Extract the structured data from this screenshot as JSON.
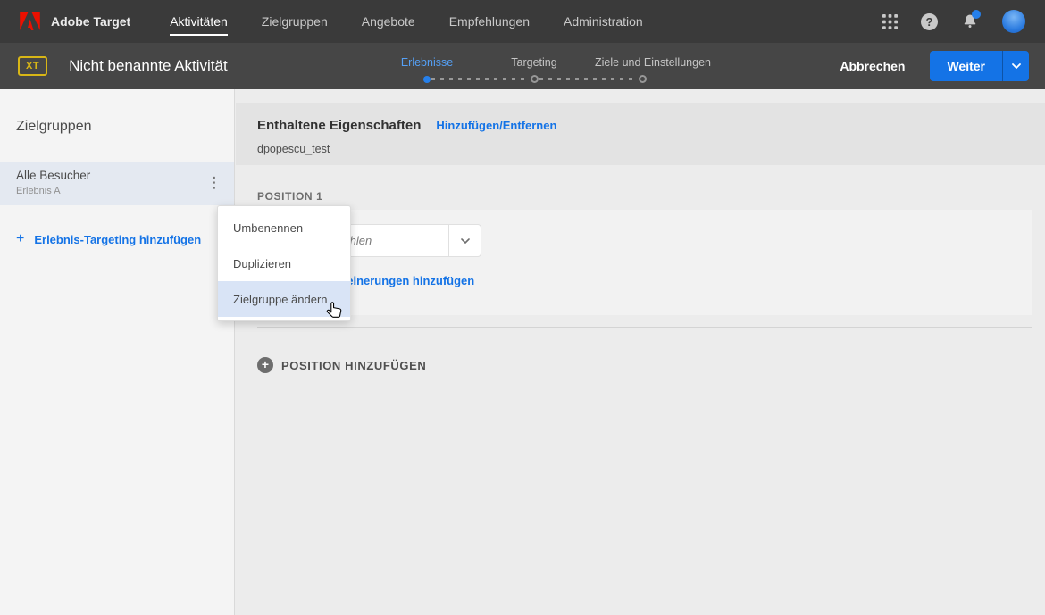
{
  "top_nav": {
    "brand": "Adobe Target",
    "items": [
      {
        "label": "Aktivitäten",
        "active": true
      },
      {
        "label": "Zielgruppen",
        "active": false
      },
      {
        "label": "Angebote",
        "active": false
      },
      {
        "label": "Empfehlungen",
        "active": false
      },
      {
        "label": "Administration",
        "active": false
      }
    ]
  },
  "activity_bar": {
    "type_badge": "XT",
    "title": "Nicht benannte Aktivität",
    "steps": [
      {
        "label": "Erlebnisse",
        "state": "active"
      },
      {
        "label": "Targeting",
        "state": "upcoming"
      },
      {
        "label": "Ziele und Einstellungen",
        "state": "upcoming"
      }
    ],
    "cancel_label": "Abbrechen",
    "next_label": "Weiter"
  },
  "sidebar": {
    "title": "Zielgruppen",
    "audiences": [
      {
        "name": "Alle Besucher",
        "experience": "Erlebnis A",
        "selected": true
      }
    ],
    "add_targeting_label": "Erlebnis-Targeting hinzufügen"
  },
  "main": {
    "properties": {
      "title": "Enthaltene Eigenschaften",
      "action_label": "Hinzufügen/Entfernen",
      "value": "dpopescu_test"
    },
    "position": {
      "label": "POSITION 1",
      "offer_placeholder": "Angebot auswählen",
      "refinements_label": "Zielgruppenverfeinerungen hinzufügen"
    },
    "add_position_label": "POSITION HINZUFÜGEN"
  },
  "context_menu": {
    "items": [
      {
        "label": "Umbenennen",
        "hovered": false
      },
      {
        "label": "Duplizieren",
        "hovered": false
      },
      {
        "label": "Zielgruppe ändern",
        "hovered": true
      }
    ]
  },
  "icons": {
    "help_glyph": "?",
    "kebab_glyph": "⋮",
    "plus_glyph": "+"
  },
  "colors": {
    "accent_blue": "#1473e6",
    "adobe_red": "#eb1000",
    "badge_yellow": "#d8b616",
    "step_active_blue": "#55a0f5",
    "menu_hover": "#d9e4f6",
    "notification_dot": "#2680eb"
  }
}
